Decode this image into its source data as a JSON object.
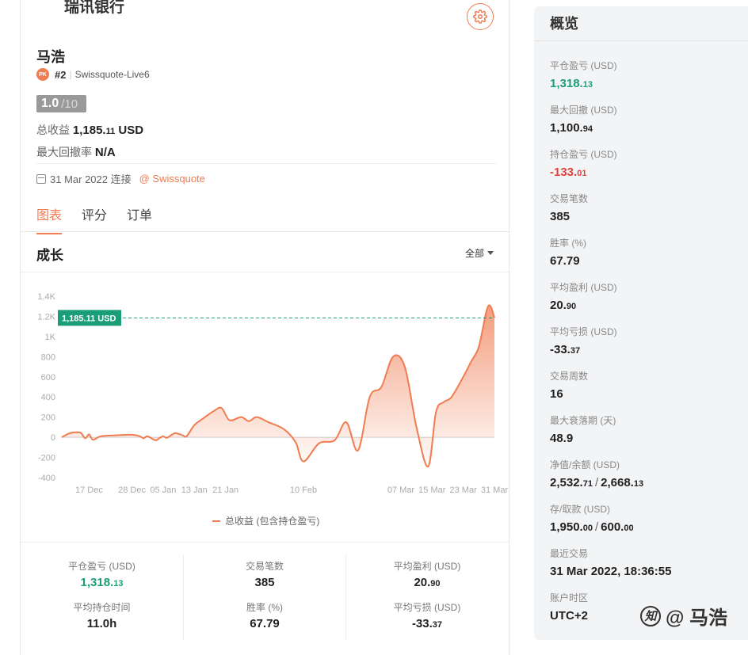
{
  "header": {
    "bank_name": "瑞讯银行"
  },
  "profile": {
    "name": "马浩",
    "rank_badge": "PK",
    "rank": "#2",
    "server": "Swissquote-Live6",
    "score": "1.0",
    "score_max": "/10",
    "total_gain_label": "总收益",
    "total_gain_int": "1,185.",
    "total_gain_dec": "11",
    "total_gain_unit": "USD",
    "max_dd_label": "最大回撤率",
    "max_dd_value": "N/A",
    "connected_date": "31 Mar 2022 连接",
    "broker": "@ Swissquote"
  },
  "tabs": [
    "图表",
    "评分",
    "订单"
  ],
  "growth": {
    "title": "成长",
    "range": "全部",
    "legend": "总收益 (包含持仓盈亏)"
  },
  "chart_data": {
    "type": "area",
    "series": [
      {
        "name": "总收益 (包含持仓盈亏)",
        "points": [
          [
            "10 Dec",
            0
          ],
          [
            "12 Dec",
            40
          ],
          [
            "14 Dec",
            50
          ],
          [
            "15 Dec",
            40
          ],
          [
            "16 Dec",
            -10
          ],
          [
            "17 Dec",
            30
          ],
          [
            "18 Dec",
            -25
          ],
          [
            "20 Dec",
            10
          ],
          [
            "24 Dec",
            20
          ],
          [
            "28 Dec",
            25
          ],
          [
            "30 Dec",
            10
          ],
          [
            "31 Dec",
            -10
          ],
          [
            "01 Jan",
            10
          ],
          [
            "03 Jan",
            -30
          ],
          [
            "04 Jan",
            -10
          ],
          [
            "05 Jan",
            10
          ],
          [
            "06 Jan",
            -5
          ],
          [
            "08 Jan",
            40
          ],
          [
            "10 Jan",
            20
          ],
          [
            "11 Jan",
            10
          ],
          [
            "13 Jan",
            120
          ],
          [
            "15 Jan",
            180
          ],
          [
            "18 Jan",
            260
          ],
          [
            "20 Jan",
            290
          ],
          [
            "22 Jan",
            170
          ],
          [
            "25 Jan",
            200
          ],
          [
            "27 Jan",
            160
          ],
          [
            "29 Jan",
            200
          ],
          [
            "01 Feb",
            150
          ],
          [
            "05 Feb",
            80
          ],
          [
            "08 Feb",
            -50
          ],
          [
            "10 Feb",
            -240
          ],
          [
            "14 Feb",
            -60
          ],
          [
            "18 Feb",
            -30
          ],
          [
            "21 Feb",
            150
          ],
          [
            "24 Feb",
            -130
          ],
          [
            "27 Feb",
            400
          ],
          [
            "02 Mar",
            500
          ],
          [
            "05 Mar",
            800
          ],
          [
            "08 Mar",
            700
          ],
          [
            "11 Mar",
            100
          ],
          [
            "14 Mar",
            -290
          ],
          [
            "16 Mar",
            250
          ],
          [
            "18 Mar",
            350
          ],
          [
            "20 Mar",
            400
          ],
          [
            "23 Mar",
            600
          ],
          [
            "25 Mar",
            750
          ],
          [
            "27 Mar",
            900
          ],
          [
            "29 Mar",
            1260
          ],
          [
            "30 Mar",
            1300
          ],
          [
            "31 Mar",
            1185
          ]
        ]
      }
    ],
    "x_ticks": [
      "17 Dec",
      "28 Dec",
      "05 Jan",
      "13 Jan",
      "21 Jan",
      "10 Feb",
      "07 Mar",
      "15 Mar",
      "23 Mar",
      "31 Mar"
    ],
    "y_ticks": [
      "1.4K",
      "1.2K",
      "1K",
      "800",
      "600",
      "400",
      "200",
      "0",
      "-200",
      "-400"
    ],
    "ylim": [
      -400,
      1400
    ],
    "current_label": "1,185.11 USD",
    "current_value": 1185.11,
    "colors": {
      "line": "#f07c52",
      "fill": "#f07c52",
      "current": "#1a9e77"
    }
  },
  "bottom_stats": [
    {
      "label": "平仓盈亏 (USD)",
      "int": "1,318.",
      "dec": "13",
      "color": "green"
    },
    {
      "label": "交易笔数",
      "int": "385",
      "dec": ""
    },
    {
      "label": "平均盈利 (USD)",
      "int": "20.",
      "dec": "90"
    },
    {
      "label": "平均持仓时间",
      "int": "11.0h",
      "dec": ""
    },
    {
      "label": "胜率 (%)",
      "int": "67.79",
      "dec": ""
    },
    {
      "label": "平均亏损 (USD)",
      "int": "-33.",
      "dec": "37"
    }
  ],
  "overview": {
    "title": "概览",
    "items": [
      {
        "label": "平仓盈亏 (USD)",
        "int": "1,318.",
        "dec": "13",
        "color": "green"
      },
      {
        "label": "最大回撤 (USD)",
        "int": "1,100.",
        "dec": "94"
      },
      {
        "label": "持仓盈亏 (USD)",
        "int": "-133.",
        "dec": "01",
        "color": "red"
      },
      {
        "label": "交易笔数",
        "int": "385",
        "dec": ""
      },
      {
        "label": "胜率 (%)",
        "int": "67.79",
        "dec": ""
      },
      {
        "label": "平均盈利 (USD)",
        "int": "20.",
        "dec": "90"
      },
      {
        "label": "平均亏损 (USD)",
        "int": "-33.",
        "dec": "37"
      },
      {
        "label": "交易周数",
        "int": "16",
        "dec": ""
      },
      {
        "label": "最大衰落期 (天)",
        "int": "48.9",
        "dec": ""
      },
      {
        "label": "净值/余额 (USD)",
        "int": "2,532.",
        "dec": "71",
        "sep": "/",
        "int2": "2,668.",
        "dec2": "13"
      },
      {
        "label": "存/取款 (USD)",
        "int": "1,950.",
        "dec": "00",
        "sep": "/",
        "int2": "600.",
        "dec2": "00"
      },
      {
        "label": "最近交易",
        "int": "31 Mar 2022, 18:36:55",
        "dec": ""
      },
      {
        "label": "账户时区",
        "int": "UTC+2",
        "dec": ""
      }
    ]
  },
  "watermark": {
    "icon": "知",
    "text": "@ 马浩"
  }
}
